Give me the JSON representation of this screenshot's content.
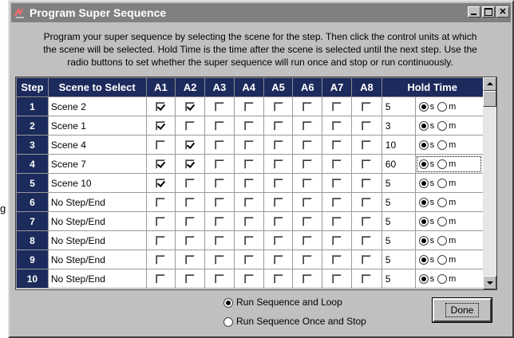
{
  "window": {
    "title": "Program Super Sequence",
    "controls": [
      "minimize",
      "maximize",
      "close"
    ]
  },
  "instructions": [
    "Program your super sequence by selecting the scene for the step.  Then click the control units at which",
    "the scene will be selected.  Hold Time is the time after the scene is selected until the next step.  Use the",
    "radio buttons to set whether the super sequence will run once and stop or run continuously."
  ],
  "table": {
    "headers": [
      "Step",
      "Scene to Select",
      "A1",
      "A2",
      "A3",
      "A4",
      "A5",
      "A6",
      "A7",
      "A8",
      "Hold Time"
    ],
    "unit_labels": {
      "seconds": "s",
      "minutes": "m"
    },
    "rows": [
      {
        "step": "1",
        "scene": "Scene 2",
        "checks": [
          true,
          true,
          false,
          false,
          false,
          false,
          false,
          false
        ],
        "hold": "5",
        "unit": "s"
      },
      {
        "step": "2",
        "scene": "Scene 1",
        "checks": [
          true,
          false,
          false,
          false,
          false,
          false,
          false,
          false
        ],
        "hold": "3",
        "unit": "s"
      },
      {
        "step": "3",
        "scene": "Scene 4",
        "checks": [
          false,
          true,
          false,
          false,
          false,
          false,
          false,
          false
        ],
        "hold": "10",
        "unit": "s"
      },
      {
        "step": "4",
        "scene": "Scene 7",
        "checks": [
          true,
          true,
          false,
          false,
          false,
          false,
          false,
          false
        ],
        "hold": "60",
        "unit": "s"
      },
      {
        "step": "5",
        "scene": "Scene 10",
        "checks": [
          true,
          false,
          false,
          false,
          false,
          false,
          false,
          false
        ],
        "hold": "5",
        "unit": "s"
      },
      {
        "step": "6",
        "scene": "No Step/End",
        "checks": [
          false,
          false,
          false,
          false,
          false,
          false,
          false,
          false
        ],
        "hold": "5",
        "unit": "s"
      },
      {
        "step": "7",
        "scene": "No Step/End",
        "checks": [
          false,
          false,
          false,
          false,
          false,
          false,
          false,
          false
        ],
        "hold": "5",
        "unit": "s"
      },
      {
        "step": "8",
        "scene": "No Step/End",
        "checks": [
          false,
          false,
          false,
          false,
          false,
          false,
          false,
          false
        ],
        "hold": "5",
        "unit": "s"
      },
      {
        "step": "9",
        "scene": "No Step/End",
        "checks": [
          false,
          false,
          false,
          false,
          false,
          false,
          false,
          false
        ],
        "hold": "5",
        "unit": "s"
      },
      {
        "step": "10",
        "scene": "No Step/End",
        "checks": [
          false,
          false,
          false,
          false,
          false,
          false,
          false,
          false
        ],
        "hold": "5",
        "unit": "s"
      }
    ]
  },
  "run_mode": {
    "options": [
      "Run Sequence and Loop",
      "Run Sequence Once and Stop"
    ],
    "selected": "Run Sequence and Loop"
  },
  "done_button": "Done",
  "stray_text": "g",
  "colors": {
    "header_bg": "#1c2a5c",
    "title_bar": "#808080",
    "dialog_bg": "#c0c0c0"
  }
}
